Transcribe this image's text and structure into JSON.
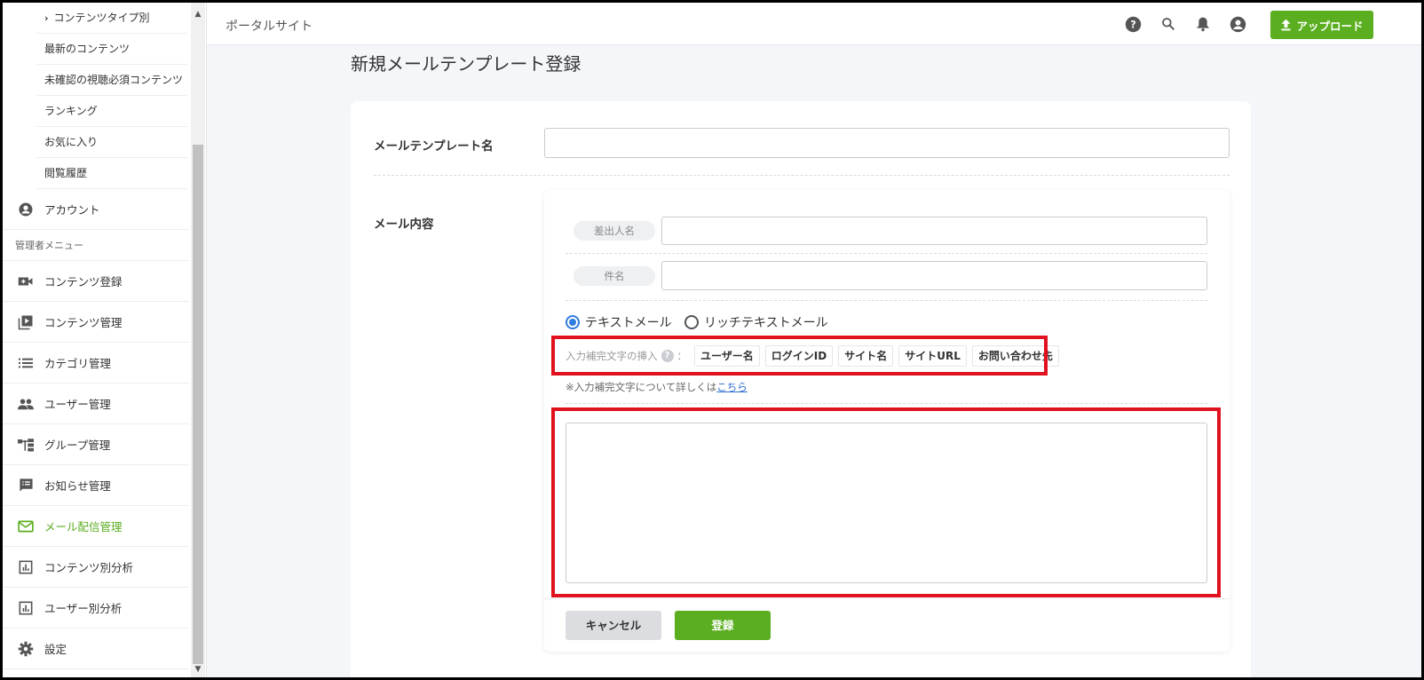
{
  "sidebar": {
    "sub_items": [
      {
        "label": "コンテンツタイプ別",
        "expandable": true
      },
      {
        "label": "最新のコンテンツ"
      },
      {
        "label": "未確認の視聴必須コンテンツ"
      },
      {
        "label": "ランキング"
      },
      {
        "label": "お気に入り"
      },
      {
        "label": "閲覧履歴"
      }
    ],
    "account_label": "アカウント",
    "admin_section_label": "管理者メニュー",
    "admin_items": [
      {
        "label": "コンテンツ登録",
        "icon": "video-add-icon"
      },
      {
        "label": "コンテンツ管理",
        "icon": "video-library-icon"
      },
      {
        "label": "カテゴリ管理",
        "icon": "list-icon"
      },
      {
        "label": "ユーザー管理",
        "icon": "people-icon"
      },
      {
        "label": "グループ管理",
        "icon": "hierarchy-icon"
      },
      {
        "label": "お知らせ管理",
        "icon": "announcement-icon"
      },
      {
        "label": "メール配信管理",
        "icon": "mail-icon",
        "active": true
      },
      {
        "label": "コンテンツ別分析",
        "icon": "chart-icon"
      },
      {
        "label": "ユーザー別分析",
        "icon": "chart-icon"
      },
      {
        "label": "設定",
        "icon": "gear-icon"
      }
    ],
    "active_color": "#5aae1f"
  },
  "header": {
    "site_name": "ポータルサイト",
    "upload_label": "アップロード",
    "icons": [
      "help-icon",
      "search-icon",
      "bell-icon",
      "account-icon"
    ]
  },
  "main": {
    "page_title": "新規メールテンプレート登録",
    "template_name_label": "メールテンプレート名",
    "template_name_value": "",
    "mail_content_label": "メール内容",
    "sender_pill": "差出人名",
    "sender_value": "",
    "subject_pill": "件名",
    "subject_value": "",
    "format_options": [
      {
        "label": "テキストメール",
        "selected": true
      },
      {
        "label": "リッチテキストメール",
        "selected": false
      }
    ],
    "insert_label": "入力補完文字の挿入",
    "insert_colon": "：",
    "insert_tags": [
      "ユーザー名",
      "ログインID",
      "サイト名",
      "サイトURL",
      "お問い合わせ先"
    ],
    "note_text": "※入力補完文字について詳しくは",
    "note_link": "こちら",
    "body_value": "",
    "cancel_label": "キャンセル",
    "submit_label": "登録"
  },
  "colors": {
    "accent": "#5aae1f",
    "highlight": "#e0121e",
    "radio": "#2f7de1"
  }
}
